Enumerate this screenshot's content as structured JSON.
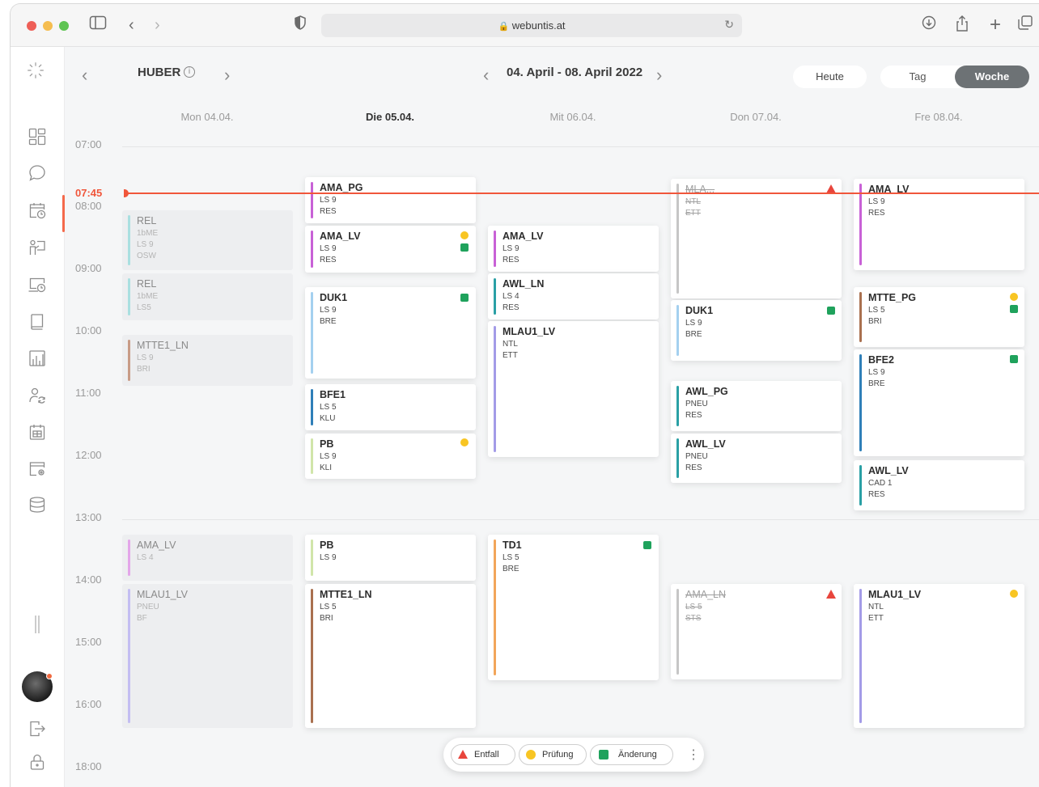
{
  "browser": {
    "url": "webuntis.at"
  },
  "header": {
    "teacher": "HUBER",
    "info_icon": "i",
    "week_range": "04. April - 08. April 2022",
    "today_label": "Heute",
    "day_label": "Tag",
    "week_label": "Woche"
  },
  "days": [
    "Mon 04.04.",
    "Die 05.04.",
    "Mit 06.04.",
    "Don 07.04.",
    "Fre 08.04."
  ],
  "times": [
    "07:00",
    "08:00",
    "09:00",
    "10:00",
    "11:00",
    "12:00",
    "13:00",
    "14:00",
    "15:00",
    "16:00",
    "18:00"
  ],
  "now_time": "07:45",
  "lessons": [
    {
      "subject": "REL",
      "line2": "1bME",
      "line3": "LS 9"
    },
    {
      "subject": "REL",
      "line2": "1bME",
      "line3": "LS5"
    },
    {
      "subject": "MTTE1_LN",
      "line2": "LS 9",
      "line3": "BRI"
    },
    {
      "subject": "AMA_LV",
      "line2": "LS 4",
      "line3": ""
    },
    {
      "subject": "MLAU1_LV",
      "line2": "PNEU",
      "line3": "BF"
    },
    {
      "subject": "AMA_PG",
      "line2": "LS 9",
      "line3": "RES"
    },
    {
      "subject": "AMA_LV",
      "line2": "LS 9",
      "line3": "RES"
    },
    {
      "subject": "DUK1",
      "line2": "LS 9",
      "line3": "BRE"
    },
    {
      "subject": "BFE1",
      "line2": "LS 5",
      "line3": "KLU"
    },
    {
      "subject": "PB",
      "line2": "LS 9",
      "line3": "KLI"
    },
    {
      "subject": "PB",
      "line2": "LS 9",
      "line3": ""
    },
    {
      "subject": "MTTE1_LN",
      "line2": "LS 5",
      "line3": "BRI"
    },
    {
      "subject": "AMA_LV",
      "line2": "LS 9",
      "line3": "RES"
    },
    {
      "subject": "AWL_LN",
      "line2": "LS 4",
      "line3": "RES"
    },
    {
      "subject": "MLAU1_LV",
      "line2": "NTL",
      "line3": "ETT"
    },
    {
      "subject": "TD1",
      "line2": "LS 5",
      "line3": "BRE"
    },
    {
      "subject": "MLA...",
      "line2": "NTL",
      "line3": "ETT"
    },
    {
      "subject": "DUK1",
      "line2": "LS 9",
      "line3": "BRE"
    },
    {
      "subject": "AWL_PG",
      "line2": "PNEU",
      "line3": "RES"
    },
    {
      "subject": "AWL_LV",
      "line2": "PNEU",
      "line3": "RES"
    },
    {
      "subject": "AMA_LN",
      "line2": "LS 5",
      "line3": "STS"
    },
    {
      "subject": "AMA_LV",
      "line2": "LS 9",
      "line3": "RES"
    },
    {
      "subject": "MTTE_PG",
      "line2": "LS 5",
      "line3": "BRI"
    },
    {
      "subject": "BFE2",
      "line2": "LS 9",
      "line3": "BRE"
    },
    {
      "subject": "AWL_LV",
      "line2": "CAD 1",
      "line3": "RES"
    },
    {
      "subject": "MLAU1_LV",
      "line2": "NTL",
      "line3": "ETT"
    }
  ],
  "legend": {
    "cancel": "Entfall",
    "exam": "Prüfung",
    "change": "Änderung",
    "more": "⋮"
  },
  "colors": {
    "now": "#f0563b",
    "exam": "#f8c523",
    "change": "#1fa25c",
    "cancel": "#e8453c"
  }
}
